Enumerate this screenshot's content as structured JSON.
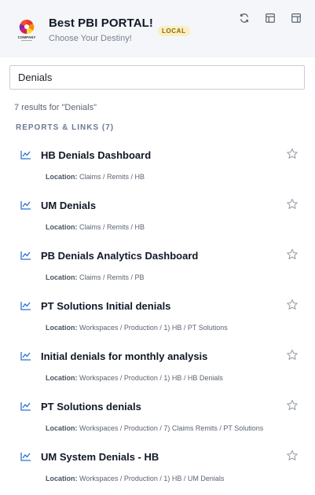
{
  "header": {
    "title": "Best PBI PORTAL!",
    "subtitle": "Choose Your Destiny!",
    "badge": "LOCAL",
    "logo_text": "COMPANY",
    "icons": [
      "refresh-icon",
      "layout-panel-icon",
      "side-panel-icon"
    ]
  },
  "search": {
    "value": "Denials",
    "placeholder": ""
  },
  "results_summary": "7 results for \"Denials\"",
  "section": {
    "label": "REPORTS & LINKS (7)"
  },
  "location_label": "Location:",
  "results": [
    {
      "title": "HB Denials Dashboard",
      "location": "Claims / Remits / HB"
    },
    {
      "title": "UM Denials",
      "location": "Claims / Remits / HB"
    },
    {
      "title": "PB Denials Analytics Dashboard",
      "location": "Claims / Remits / PB"
    },
    {
      "title": "PT Solutions Initial denials",
      "location": "Workspaces / Production / 1) HB / PT Solutions"
    },
    {
      "title": "Initial denials for monthly analysis",
      "location": "Workspaces / Production / 1) HB / HB Denials"
    },
    {
      "title": "PT Solutions denials",
      "location": "Workspaces / Production / 7) Claims Remits / PT Solutions"
    },
    {
      "title": "UM System Denials - HB",
      "location": "Workspaces / Production / 1) HB / UM Denials"
    }
  ],
  "colors": {
    "accent": "#2f6fd6",
    "header_bg": "#f4f6f9",
    "badge_bg": "#fbeec2",
    "section_label": "#6b7a8f"
  }
}
